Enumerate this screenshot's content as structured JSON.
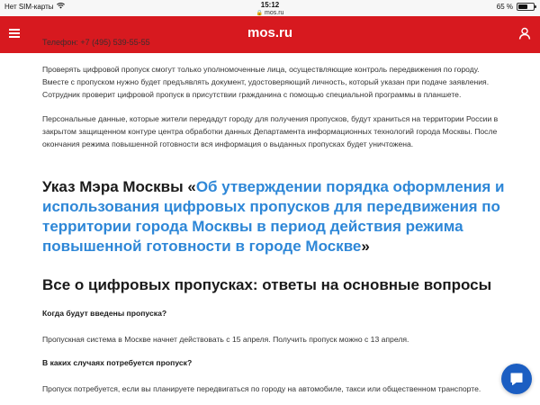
{
  "status_bar": {
    "carrier": "Нет SIM-карты",
    "time": "15:12",
    "url": "mos.ru",
    "battery": "65 %",
    "battery_level": 0.65
  },
  "header": {
    "title": "mos.ru"
  },
  "content": {
    "cut_line": "Телефон: +7 (495) 539-55-55",
    "para1": "Проверять цифровой пропуск смогут только уполномоченные лица, осуществляющие контроль передвижения по городу. Вместе с пропуском нужно будет предъявлять документ, удостоверяющий личность, который указан при подаче заявления. Сотрудник проверит цифровой пропуск в присутствии гражданина с помощью специальной программы в планшете.",
    "para2": "Персональные данные, которые жители передадут городу для получения пропусков, будут храниться на территории России в закрытом защищенном контуре центра обработки данных Департамента информационных технологий города Москвы. После окончания режима повышенной готовности вся информация о выданных пропусках будет уничтожена.",
    "ukaz_prefix": "Указ Мэра Москвы «",
    "ukaz_link": "Об утверждении порядка оформления и использования цифровых пропусков для передвижения по территории города Москвы в период действия режима повышенной готовности в городе Москве",
    "ukaz_suffix": "»",
    "section_title": "Все о цифровых пропусках: ответы на основные вопросы",
    "q1": "Когда будут введены пропуска?",
    "a1": "Пропускная система в Москве начнет действовать с 15 апреля. Получить пропуск можно с 13 апреля.",
    "q2": "В каких случаях потребуется пропуск?",
    "a2": "Пропуск потребуется, если вы планируете передвигаться по городу на автомобиле, такси или общественном транспорте."
  },
  "colors": {
    "header_bg": "#d7191f",
    "link": "#2e87d7",
    "chat_button": "#1b5ec2"
  },
  "icons": {
    "menu": "hamburger-icon",
    "user": "user-icon",
    "chat": "chat-bubble-icon",
    "wifi": "wifi-icon",
    "lock": "lock-icon",
    "battery": "battery-icon"
  }
}
